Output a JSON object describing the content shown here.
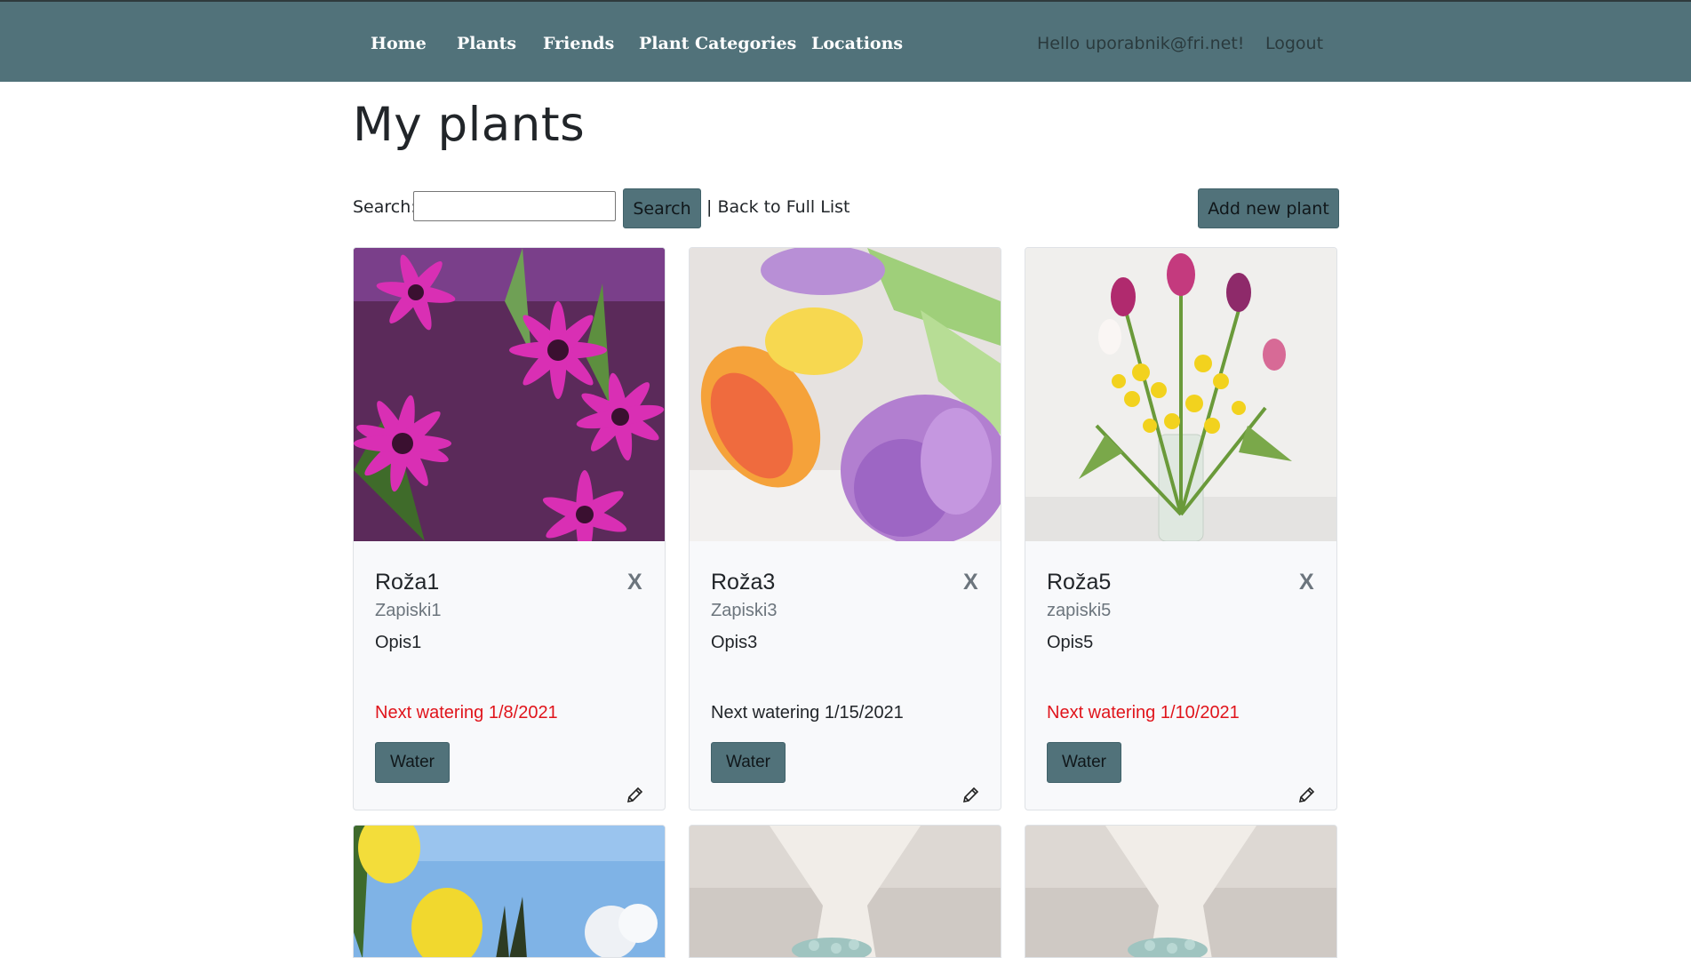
{
  "nav": {
    "links": [
      "Home",
      "Plants",
      "Friends",
      "Plant Categories",
      "Locations"
    ],
    "greeting": "Hello uporabnik@fri.net!",
    "logout": "Logout"
  },
  "page": {
    "title": "My plants",
    "search_label": "Search:",
    "search_value": "",
    "search_button": "Search",
    "back_link": "| Back to Full List",
    "add_button": "Add new plant"
  },
  "cards": [
    {
      "title": "Roža1",
      "close": "X",
      "notes": "Zapiski1",
      "desc": "Opis1",
      "watering": "Next watering 1/8/2021",
      "overdue": true,
      "water_button": "Water"
    },
    {
      "title": "Roža3",
      "close": "X",
      "notes": "Zapiski3",
      "desc": "Opis3",
      "watering": "Next watering 1/15/2021",
      "overdue": false,
      "water_button": "Water"
    },
    {
      "title": "Roža5",
      "close": "X",
      "notes": "zapiski5",
      "desc": "Opis5",
      "watering": "Next watering 1/10/2021",
      "overdue": true,
      "water_button": "Water"
    }
  ],
  "colors": {
    "navbar": "#51727a",
    "button": "#51727a",
    "overdue": "#e0141b"
  }
}
